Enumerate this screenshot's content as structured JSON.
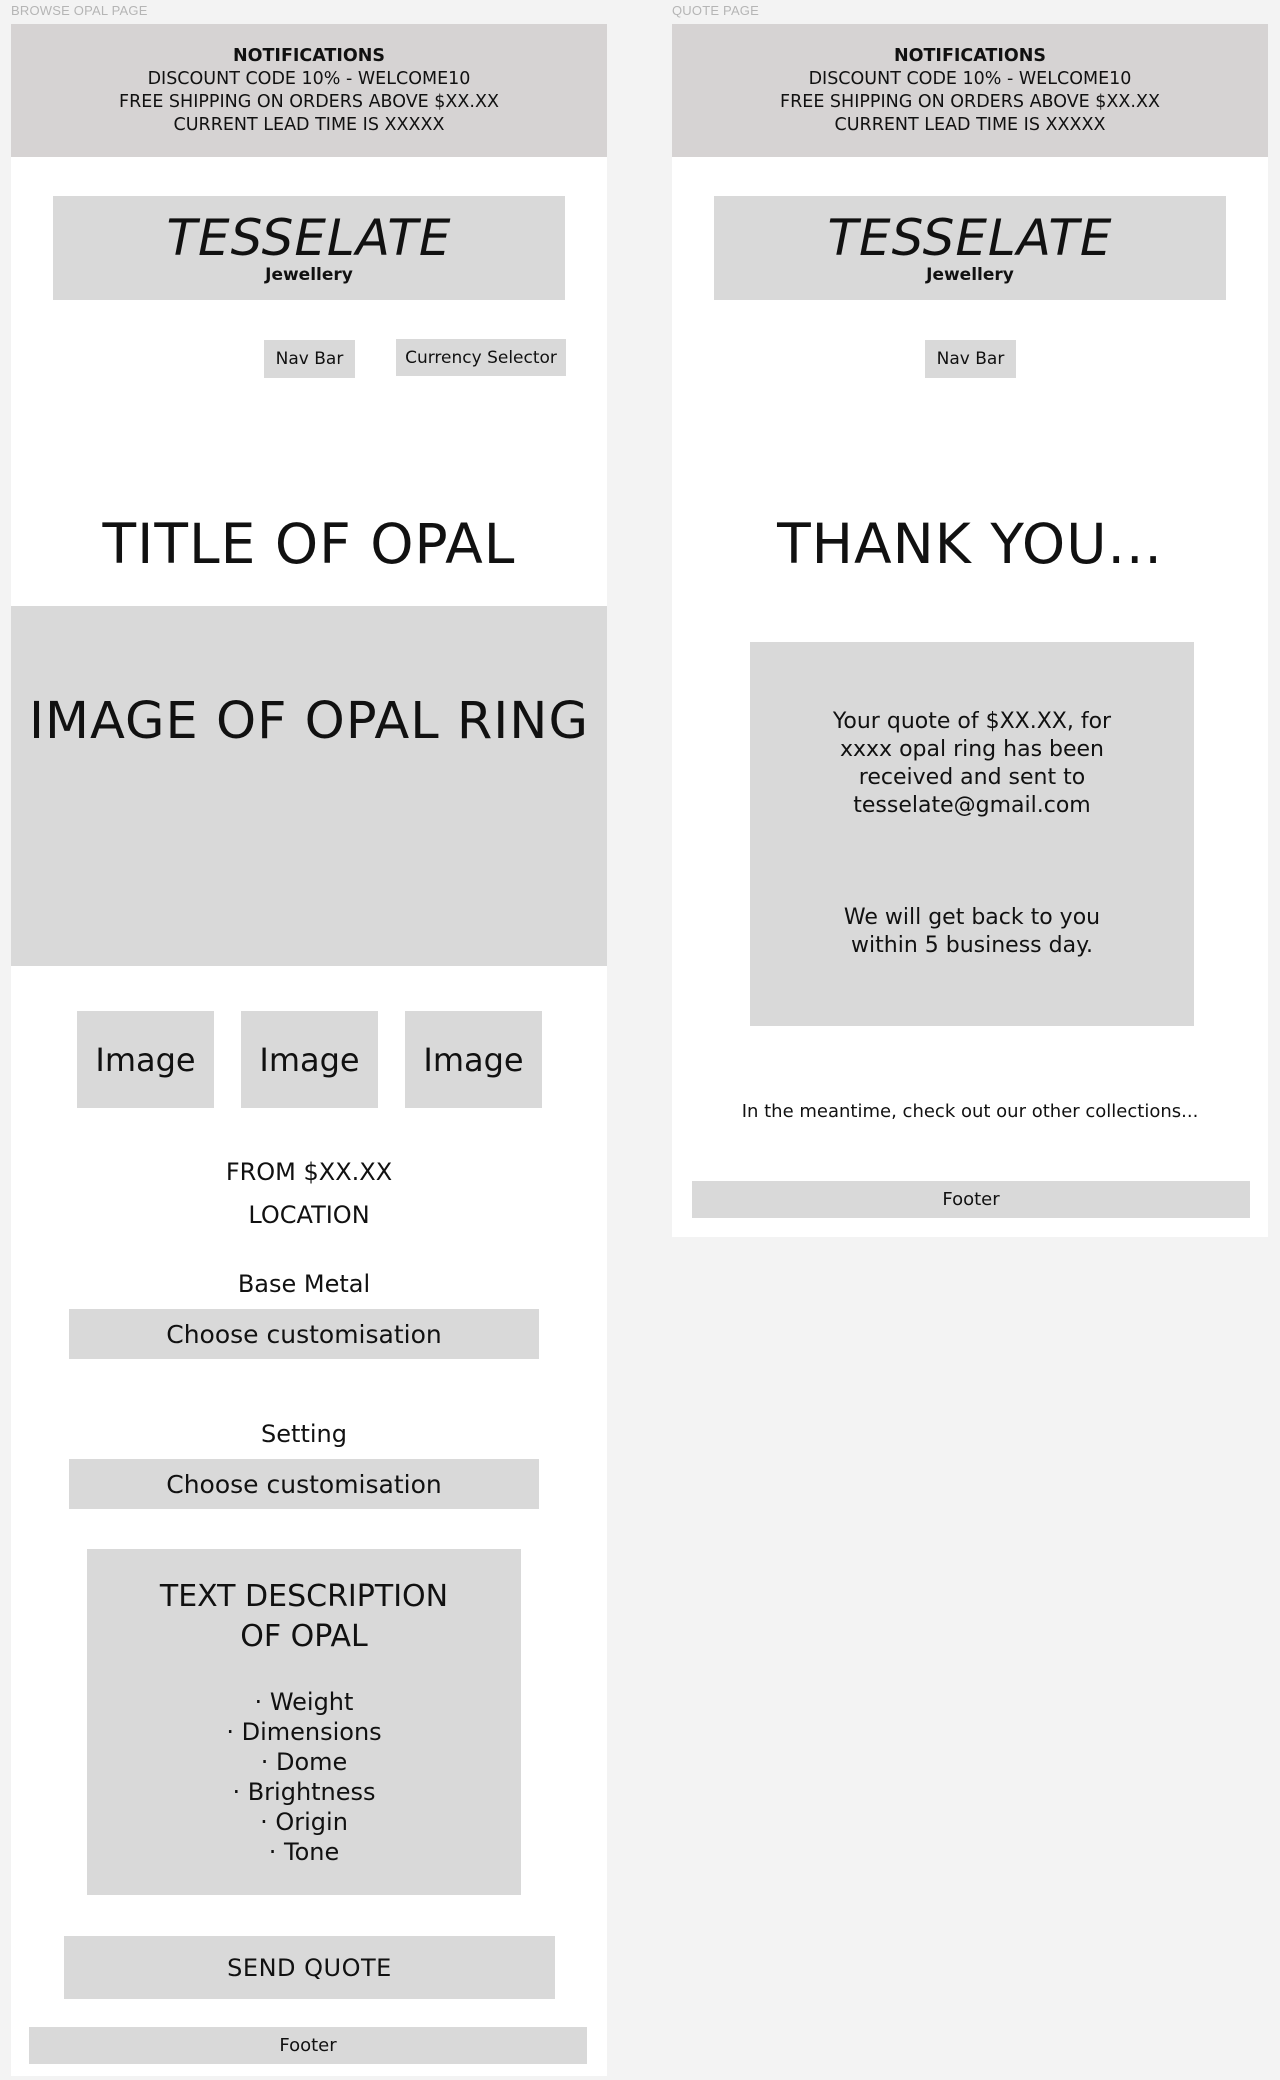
{
  "browse_page": {
    "frame_label": "BROWSE OPAL PAGE",
    "notifications": {
      "title": "NOTIFICATIONS",
      "lines": [
        "DISCOUNT CODE 10% - WELCOME10",
        "FREE SHIPPING ON ORDERS ABOVE $XX.XX",
        "CURRENT LEAD TIME IS XXXXX"
      ]
    },
    "logo": {
      "brand": "TESSELATE",
      "sub": "Jewellery"
    },
    "nav_bar": "Nav Bar",
    "currency_selector": "Currency Selector",
    "title": "TITLE OF OPAL",
    "hero_image": "IMAGE OF OPAL RING",
    "thumbnails": [
      "Image",
      "Image",
      "Image"
    ],
    "price": "FROM $XX.XX",
    "location": "LOCATION",
    "base_metal": {
      "label": "Base Metal",
      "select": "Choose customisation"
    },
    "setting": {
      "label": "Setting",
      "select": "Choose customisation"
    },
    "description": {
      "title_line1": "TEXT DESCRIPTION",
      "title_line2": "OF OPAL",
      "items": [
        "Weight",
        "Dimensions",
        "Dome",
        "Brightness",
        "Origin",
        "Tone"
      ]
    },
    "send_quote": "SEND QUOTE",
    "footer": "Footer"
  },
  "quote_page": {
    "frame_label": "QUOTE PAGE",
    "notifications": {
      "title": "NOTIFICATIONS",
      "lines": [
        "DISCOUNT CODE 10% - WELCOME10",
        "FREE SHIPPING ON ORDERS ABOVE $XX.XX",
        "CURRENT LEAD TIME IS XXXXX"
      ]
    },
    "logo": {
      "brand": "TESSELATE",
      "sub": "Jewellery"
    },
    "nav_bar": "Nav Bar",
    "title": "THANK YOU...",
    "message": {
      "lines": [
        "Your quote of $XX.XX, for",
        "xxxx opal ring has been",
        "received and sent to",
        "tesselate@gmail.com"
      ],
      "followup": [
        "We will get back to you",
        "within 5 business day."
      ]
    },
    "meantime": "In the meantime, check out our other collections...",
    "footer": "Footer"
  }
}
